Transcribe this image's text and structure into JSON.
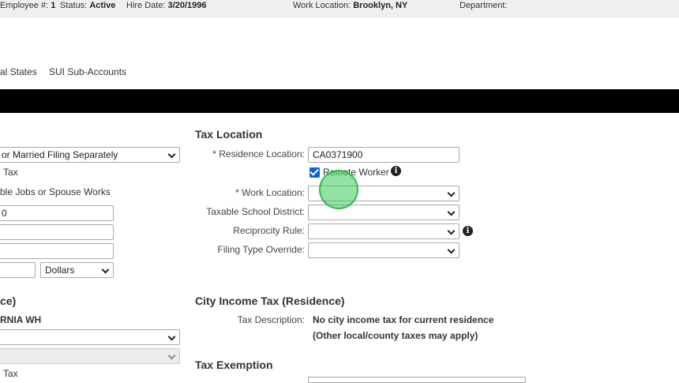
{
  "header": {
    "employee_label": "Employee #:",
    "employee_value": "1",
    "status_label": "Status:",
    "status_value": "Active",
    "hire_label": "Hire Date:",
    "hire_value": "3/20/1996",
    "work_location_label": "Work Location:",
    "work_location_value": "Brooklyn, NY",
    "department_label": "Department:"
  },
  "tabs": [
    "al States",
    "SUI Sub-Accounts"
  ],
  "left": {
    "filing_status": "or Married Filing Separately",
    "tax_text_1": "Tax",
    "jobs_text": "ble Jobs or Spouse Works",
    "input_1": "0",
    "input_2": "",
    "input_3": "",
    "input_4": "",
    "dollars": "Dollars",
    "section_title": "ce)",
    "wh_label": "RNIA WH",
    "select_1": "",
    "select_2": "",
    "tax_text_2": "Tax"
  },
  "tax_location": {
    "title": "Tax Location",
    "residence_label": "* Residence Location:",
    "residence_value": "CA0371900",
    "remote_worker_label": "Remote Worker",
    "remote_worker_checked": true,
    "work_location_label": "* Work Location:",
    "work_location_value": "",
    "school_district_label": "Taxable School District:",
    "school_district_value": "",
    "reciprocity_label": "Reciprocity Rule:",
    "reciprocity_value": "",
    "filing_override_label": "Filing Type Override:",
    "filing_override_value": ""
  },
  "city_tax": {
    "title": "City Income Tax (Residence)",
    "desc_label": "Tax Description:",
    "desc_line1": "No city income tax for current residence",
    "desc_line2": "(Other local/county taxes may apply)"
  },
  "exemption": {
    "title": "Tax Exemption"
  },
  "icons": {
    "info": "i"
  }
}
